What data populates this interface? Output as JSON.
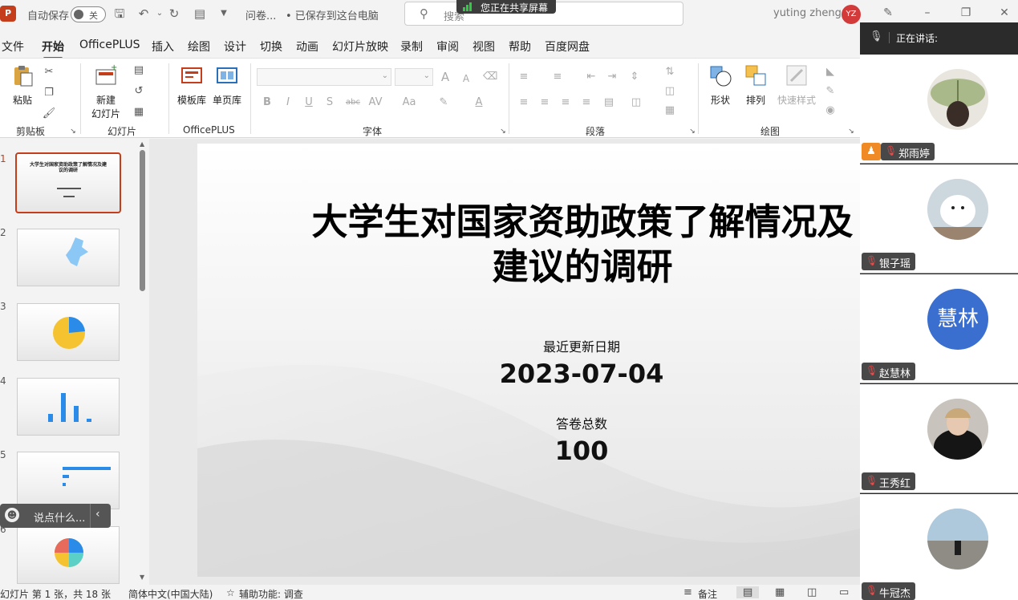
{
  "titlebar": {
    "app_logo": "P",
    "autosave_label": "自动保存",
    "autosave_state": "关",
    "doc_name": "问卷...",
    "save_status": "• 已保存到这台电脑",
    "search_placeholder": "搜索",
    "share_banner": "您正在共享屏幕",
    "user_name": "yuting zheng",
    "user_initials": "YZ",
    "icons": [
      "save-icon",
      "undo-icon",
      "redo-icon",
      "present-icon",
      "customize-icon",
      "pen-icon",
      "minimize-icon",
      "restore-icon",
      "close-icon"
    ]
  },
  "ribbon_tabs": [
    "文件",
    "开始",
    "OfficePLUS",
    "插入",
    "绘图",
    "设计",
    "切换",
    "动画",
    "幻灯片放映",
    "录制",
    "审阅",
    "视图",
    "帮助",
    "百度网盘"
  ],
  "active_tab": "开始",
  "ribbon": {
    "clipboard": {
      "paste": "粘贴",
      "group": "剪贴板"
    },
    "slides": {
      "new_slide": "新建\n幻灯片",
      "new_slide_line1": "新建",
      "new_slide_line2": "幻灯片",
      "group": "幻灯片"
    },
    "officeplus": {
      "template": "模板库",
      "single_page": "单页库",
      "group": "OfficePLUS"
    },
    "font": {
      "group": "字体",
      "bold": "B",
      "italic": "I",
      "underline": "U",
      "shadow": "S",
      "strike": "abc",
      "spacing": "AV",
      "case": "Aa",
      "grow": "A",
      "shrink": "A"
    },
    "paragraph": {
      "group": "段落"
    },
    "drawing": {
      "shapes": "形状",
      "arrange": "排列",
      "quick_styles": "快速样式",
      "group": "绘图"
    }
  },
  "slides_panel": {
    "numbers": [
      "1",
      "2",
      "3",
      "4",
      "5",
      "6"
    ],
    "thumb_titles": [
      "大学生对国家资助政策了解情况及建议的调研",
      "",
      "",
      "",
      "",
      ""
    ],
    "chat_placeholder": "说点什么..."
  },
  "slide": {
    "title_line1": "大学生对国家资助政策了解情况及",
    "title_line2": "建议的调研",
    "date_label": "最近更新日期",
    "date_value": "2023-07-04",
    "count_label": "答卷总数",
    "count_value": "100"
  },
  "statusbar": {
    "slide_info": "幻灯片 第 1 张，共 18 张",
    "language": "简体中文(中国大陆)",
    "accessibility": "辅助功能: 调查",
    "notes": "备注"
  },
  "meeting": {
    "speaking_label": "正在讲话:",
    "participants": [
      {
        "name": "郑雨婷",
        "host": true,
        "avatar_text": ""
      },
      {
        "name": "银子瑶",
        "host": false,
        "avatar_text": ""
      },
      {
        "name": "赵慧林",
        "host": false,
        "avatar_text": "慧林"
      },
      {
        "name": "王秀红",
        "host": false,
        "avatar_text": ""
      },
      {
        "name": "牛冠杰",
        "host": false,
        "avatar_text": ""
      }
    ]
  },
  "colors": {
    "accent": "#c43e1c",
    "meeting_bg": "#2b2b2b",
    "avatar_blue": "#3a6fd0"
  }
}
